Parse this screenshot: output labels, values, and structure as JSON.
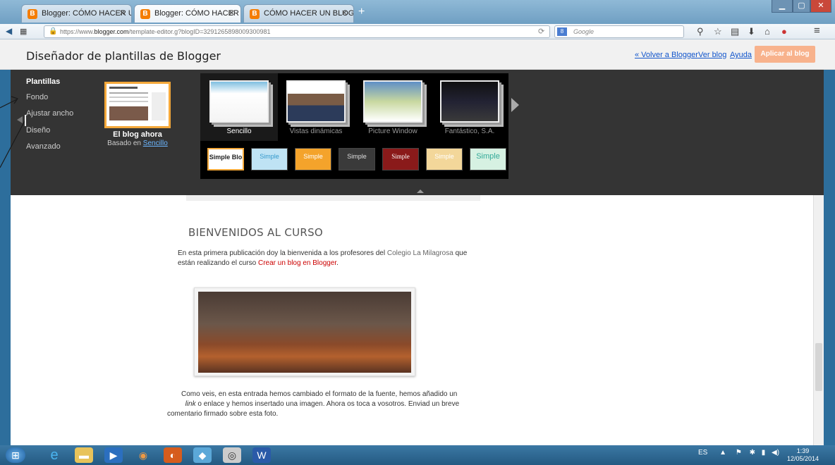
{
  "browser": {
    "tabs": [
      {
        "label": "Blogger: CÓMO HACER U...",
        "icon": "blogger-icon"
      },
      {
        "label": "Blogger: CÓMO HACER U...",
        "icon": "blogger-icon",
        "active": true
      },
      {
        "label": "CÓMO HACER UN BLOG: B...",
        "icon": "blogger-icon"
      }
    ],
    "url_prefix": "https://www.",
    "url_domain": "blogger.com",
    "url_path": "/template-editor.g?blogID=3291265898009300981",
    "search_placeholder": "Google"
  },
  "header": {
    "title": "Diseñador de plantillas de Blogger",
    "back_link": "« Volver a Blogger",
    "view_blog_link": "Ver blog",
    "help_link": "Ayuda",
    "apply_button": "Aplicar al blog"
  },
  "designer": {
    "menu_title": "Plantillas",
    "menu_items": [
      "Fondo",
      "Ajustar ancho",
      "Diseño",
      "Avanzado"
    ],
    "current_title": "El blog ahora",
    "current_based_prefix": "Basado en ",
    "current_based_link": "Sencillo",
    "templates": [
      "Sencillo",
      "Vistas dinámicas",
      "Picture Window",
      "Fantástico, S.A."
    ],
    "variants": [
      "Simple Blo",
      "Simple",
      "Simple",
      "Simple",
      "Simple",
      "Simple",
      "Simple"
    ]
  },
  "post": {
    "title": "BIENVENIDOS AL CURSO",
    "intro_1": "En esta primera publicación doy la bienvenida a los profesores del ",
    "intro_school": "Colegio La Milagrosa",
    "intro_2": " que",
    "intro_3": "están realizando el curso ",
    "intro_link": "Crear un blog en Blogger",
    "intro_end": ".",
    "body_1": "Como veis, en esta entrada hemos cambiado el formato de la fuente, hemos añadido un",
    "body_2a": "link",
    "body_2b": " o enlace y hemos insertado una imagen. Ahora os toca a vosotros. Enviad un breve",
    "body_3": "comentario firmado sobre esta foto."
  },
  "taskbar": {
    "lang": "ES",
    "time": "1:39",
    "date": "12/05/2014"
  },
  "colors": {
    "accent_orange": "#f4a83a",
    "apply_button": "#f8b28c",
    "panel_bg": "#343434",
    "link_red": "#cc0000"
  }
}
